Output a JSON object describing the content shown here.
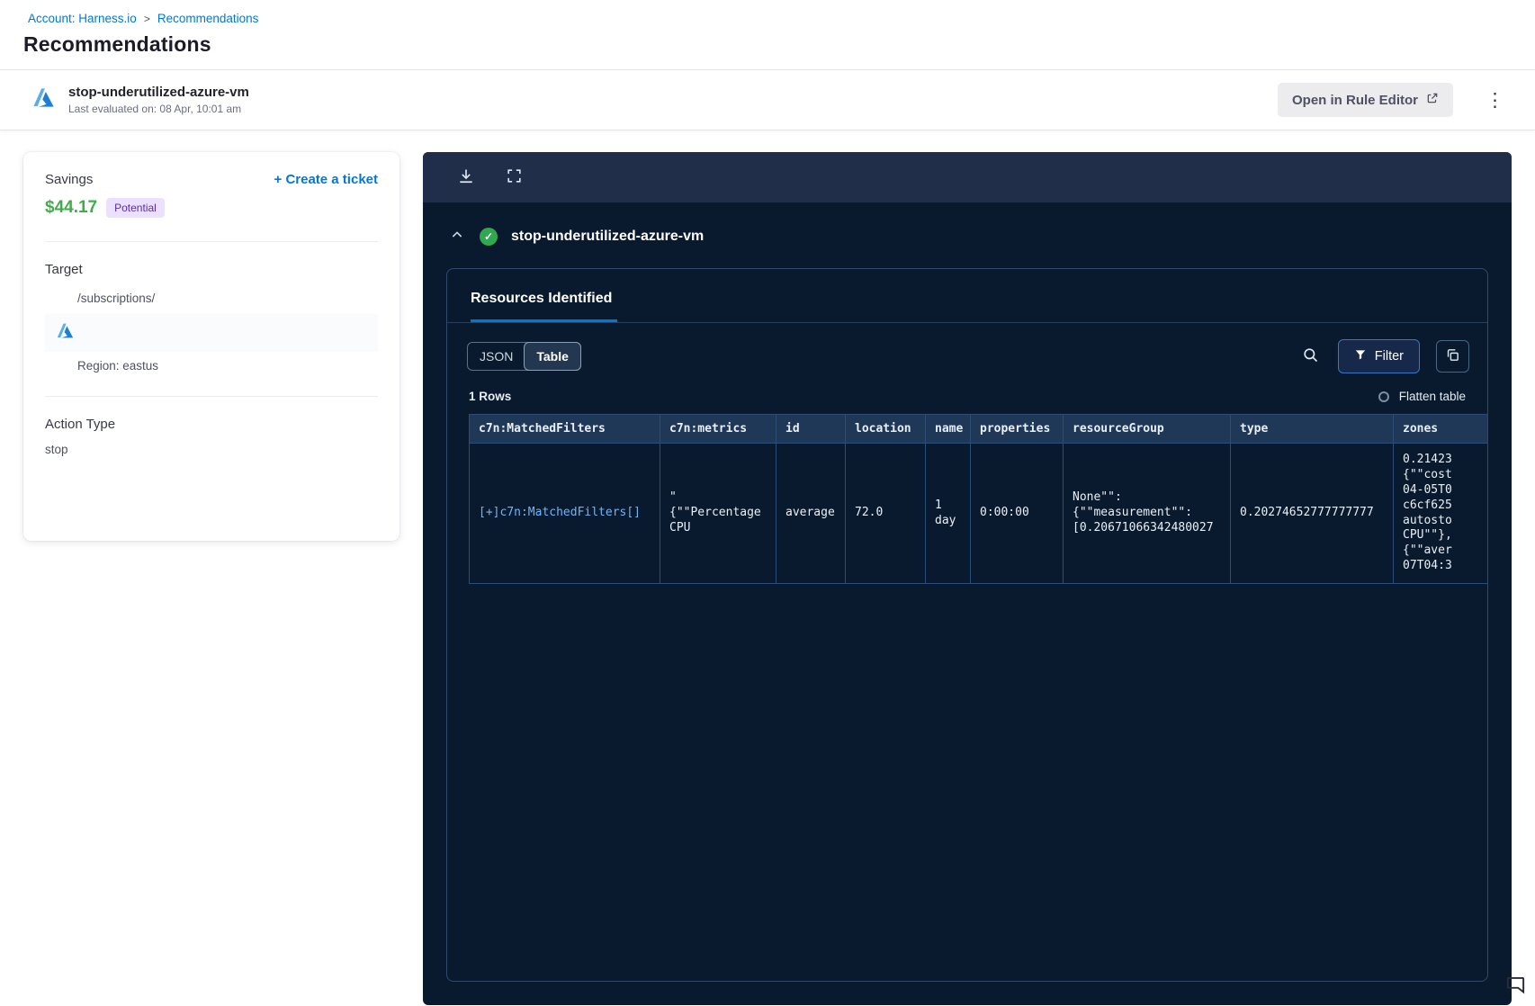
{
  "breadcrumb": {
    "account_link": "Account: Harness.io",
    "separator": ">",
    "current_link": "Recommendations"
  },
  "page_title": "Recommendations",
  "header": {
    "title": "stop-underutilized-azure-vm",
    "subtitle": "Last evaluated on: 08 Apr, 10:01 am",
    "open_rule_editor_label": "Open in Rule Editor"
  },
  "savings_card": {
    "savings_label": "Savings",
    "create_ticket_label": "+ Create a ticket",
    "amount": "$44.17",
    "badge": "Potential",
    "target_label": "Target",
    "target_path": "/subscriptions/",
    "region": "Region: eastus",
    "action_type_label": "Action Type",
    "action_type_value": "stop"
  },
  "panel": {
    "title": "stop-underutilized-azure-vm",
    "tab_label": "Resources Identified",
    "view_toggle": {
      "json": "JSON",
      "table": "Table"
    },
    "filter_label": "Filter",
    "rows_count": "1 Rows",
    "flatten_label": "Flatten table",
    "table": {
      "headers": [
        "c7n:MatchedFilters",
        "c7n:metrics",
        "id",
        "location",
        "name",
        "properties",
        "resourceGroup",
        "type",
        "zones"
      ],
      "row_cells": [
        "[+]c7n:MatchedFilters[]",
        "\"\n{\"\"Percentage\nCPU",
        "average",
        "72.0",
        "1\nday",
        "0:00:00",
        "None\"\":\n{\"\"measurement\"\":\n[0.20671066342480027",
        "0.20274652777777777",
        "0.21423\n{\"\"cost\n04-05T0\nc6cf625\nautosto\nCPU\"\"},\n{\"\"aver\n07T04:3"
      ]
    }
  },
  "colors": {
    "accent_blue": "#0278d5",
    "savings_green": "#3fae49",
    "badge_purple_bg": "#ece0ff",
    "panel_dark": "#0a1a2e"
  }
}
